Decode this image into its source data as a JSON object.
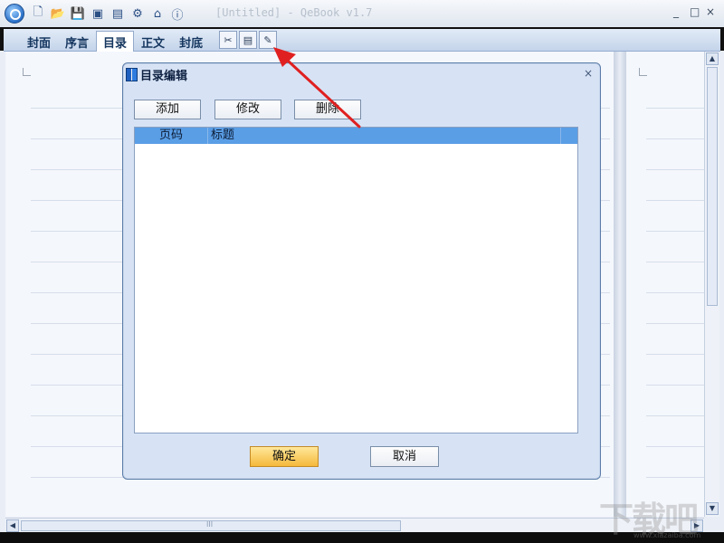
{
  "window": {
    "title": "[Untitled] - QeBook v1.7",
    "controls": [
      "_",
      "□",
      "×"
    ]
  },
  "quick_access": [
    "new-icon",
    "open-icon",
    "save-icon",
    "export-icon",
    "preview-icon",
    "publish-icon",
    "home-icon",
    "help-icon"
  ],
  "tabs": [
    {
      "label": "封面"
    },
    {
      "label": "序言"
    },
    {
      "label": "目录",
      "active": true
    },
    {
      "label": "正文"
    },
    {
      "label": "封底"
    }
  ],
  "tab_tools": [
    "settings-tool-icon",
    "page-tool-icon",
    "edit-toc-icon"
  ],
  "dialog": {
    "title": "目录编辑",
    "close": "×",
    "buttons": {
      "add": "添加",
      "edit": "修改",
      "delete": "删除"
    },
    "list": {
      "columns": [
        "页码",
        "标题"
      ],
      "rows": []
    },
    "ok": "确定",
    "cancel": "取消"
  },
  "scrollbars": {
    "up": "▲",
    "down": "▼",
    "left": "◀",
    "right": "▶",
    "grip": "III"
  },
  "watermark": {
    "text": "下载吧",
    "url": "www.xiazaiba.com"
  },
  "annotation": {
    "color": "#e02020"
  }
}
